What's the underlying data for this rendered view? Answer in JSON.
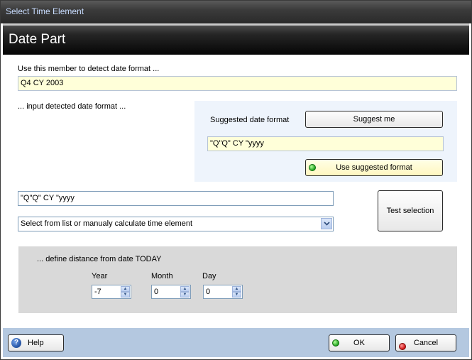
{
  "window": {
    "title": "Select Time Element"
  },
  "header": {
    "title": "Date Part"
  },
  "member": {
    "label": "Use this member to detect date format ...",
    "value": "Q4 CY 2003"
  },
  "detected": {
    "label": "... input detected date format ..."
  },
  "suggest": {
    "label": "Suggested date format",
    "button": "Suggest me",
    "value": "\"Q\"Q\" CY \"yyyy",
    "use_button": "Use suggested format"
  },
  "format": {
    "value": "\"Q\"Q\" CY \"yyyy"
  },
  "select": {
    "value": "Select from list or manualy calculate time element"
  },
  "test_button": "Test selection",
  "distance": {
    "label": "... define distance from date TODAY",
    "year_label": "Year",
    "year_value": "-7",
    "month_label": "Month",
    "month_value": "0",
    "day_label": "Day",
    "day_value": "0"
  },
  "footer": {
    "help": "Help",
    "ok": "OK",
    "cancel": "Cancel"
  },
  "icons": {
    "help": "help-icon",
    "ok": "green-status-icon",
    "cancel": "red-status-icon",
    "use": "green-status-icon"
  },
  "colors": {
    "title_text": "#c8dcff",
    "field_yellow": "#ffffd9",
    "panel_blue": "#eef4fc",
    "panel_gray": "#d9d9d9",
    "footer": "#b4c8e0"
  }
}
